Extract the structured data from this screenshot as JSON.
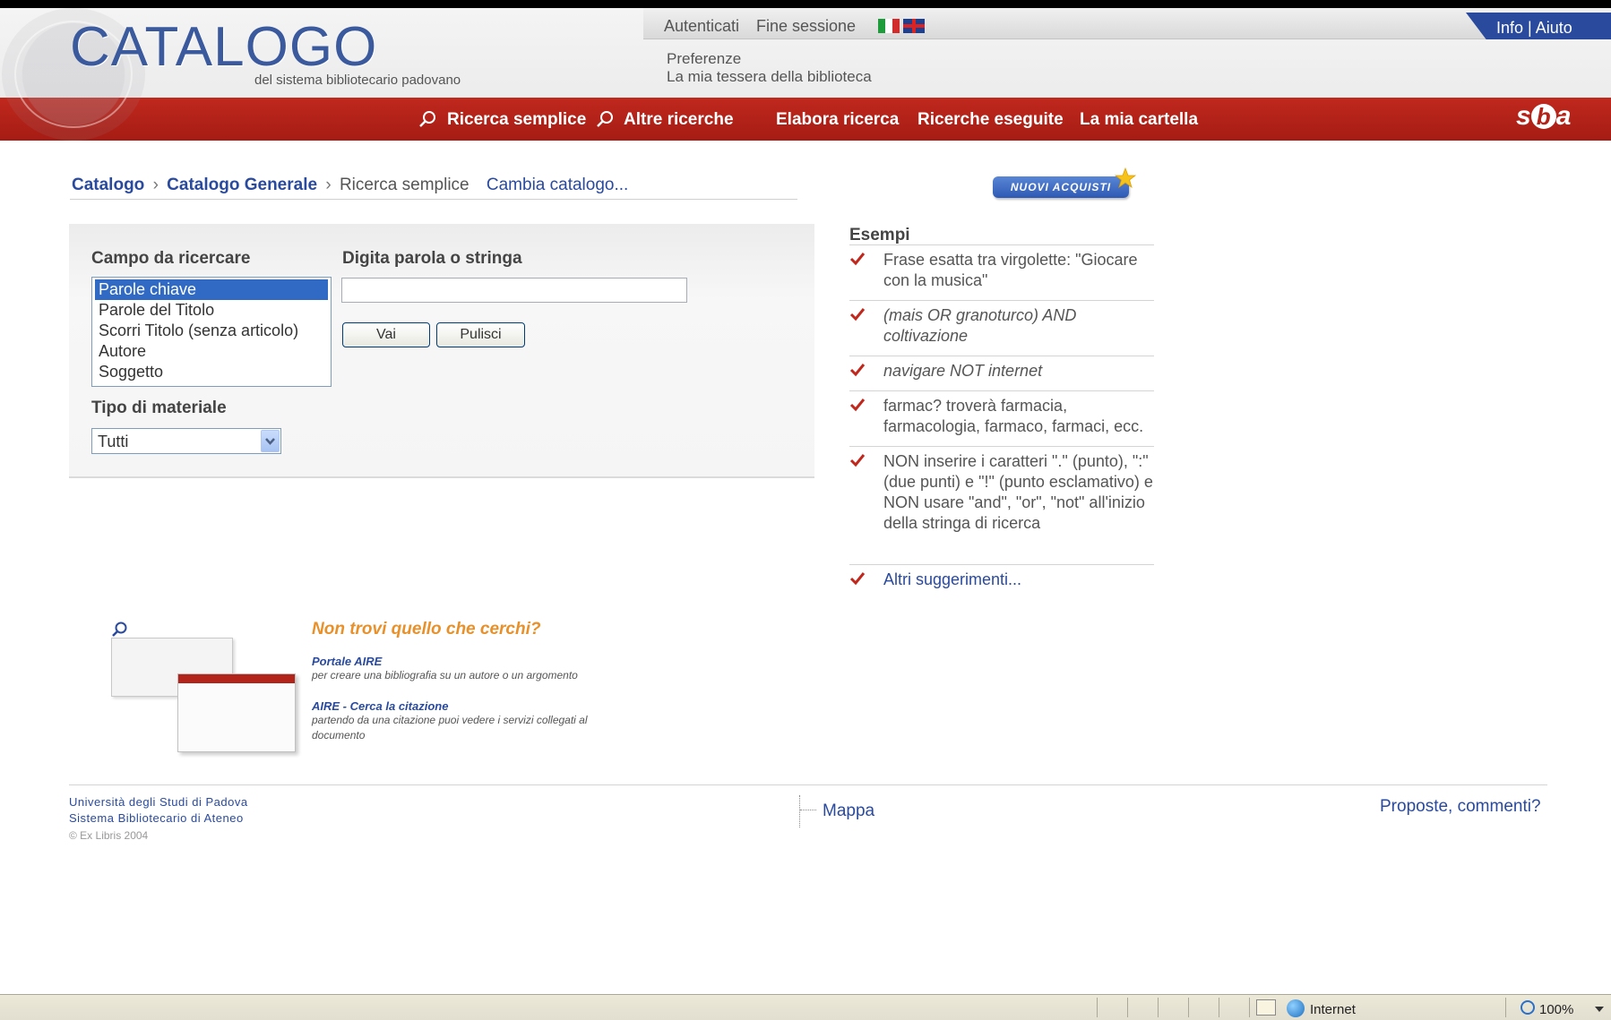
{
  "header": {
    "logo_title": "CATALOGO",
    "logo_subtitle": "del sistema bibliotecario padovano",
    "top_links": {
      "login": "Autenticati",
      "logout": "Fine sessione",
      "info_help": "Info | Aiuto"
    },
    "user_links": {
      "preferences": "Preferenze",
      "library_card": "La mia tessera della biblioteca"
    },
    "brand": {
      "s": "s",
      "b": "b",
      "a": "a"
    }
  },
  "nav": {
    "items": [
      {
        "label": "Ricerca semplice",
        "icon": "search-icon"
      },
      {
        "label": "Altre ricerche",
        "icon": "search-icon"
      },
      {
        "label": "Elabora ricerca"
      },
      {
        "label": "Ricerche eseguite"
      },
      {
        "label": "La mia cartella"
      }
    ]
  },
  "breadcrumb": {
    "items": [
      "Catalogo",
      "Catalogo Generale",
      "Ricerca semplice"
    ],
    "separator": "›",
    "change_link": "Cambia catalogo..."
  },
  "banner": {
    "new_acquisitions": "NUOVI ACQUISTI"
  },
  "search": {
    "field_label": "Campo da ricercare",
    "fields": [
      "Parole chiave",
      "Parole del Titolo",
      "Scorri Titolo (senza articolo)",
      "Autore",
      "Soggetto"
    ],
    "selected_field": "Parole chiave",
    "query_label": "Digita parola o stringa",
    "query_value": "",
    "go_button": "Vai",
    "clear_button": "Pulisci",
    "material_label": "Tipo di materiale",
    "material_value": "Tutti"
  },
  "examples": {
    "title": "Esempi",
    "items": [
      "Frase esatta tra virgolette: \"Giocare con la musica\"",
      "(mais OR granoturco) AND coltivazione",
      "navigare NOT internet",
      "farmac? troverà farmacia, farmacologia, farmaco, farmaci, ecc.",
      "NON inserire i caratteri \".\" (punto), \":\" (due punti) e \"!\" (punto esclamativo) e NON usare \"and\", \"or\", \"not\" all'inizio della stringa di ricerca",
      "Altri suggerimenti..."
    ]
  },
  "promo": {
    "title": "Non trovi quello che cerchi?",
    "link1": "Portale AIRE",
    "desc1": "per creare una bibliografia su un autore o un argomento",
    "link2": "AIRE - Cerca la citazione",
    "desc2": "partendo da una citazione puoi vedere i servizi collegati al documento"
  },
  "footer": {
    "university": "Università degli Studi di Padova",
    "system": "Sistema Bibliotecario di Ateneo",
    "copyright": "© Ex Libris 2004",
    "map": "Mappa",
    "feedback": "Proposte, commenti?"
  },
  "statusbar": {
    "zone": "Internet",
    "zoom": "100%"
  },
  "colors": {
    "nav_red": "#b2231a",
    "link_blue": "#2a4a9e",
    "promo_orange": "#e8902a",
    "selection_blue": "#316ac5"
  }
}
